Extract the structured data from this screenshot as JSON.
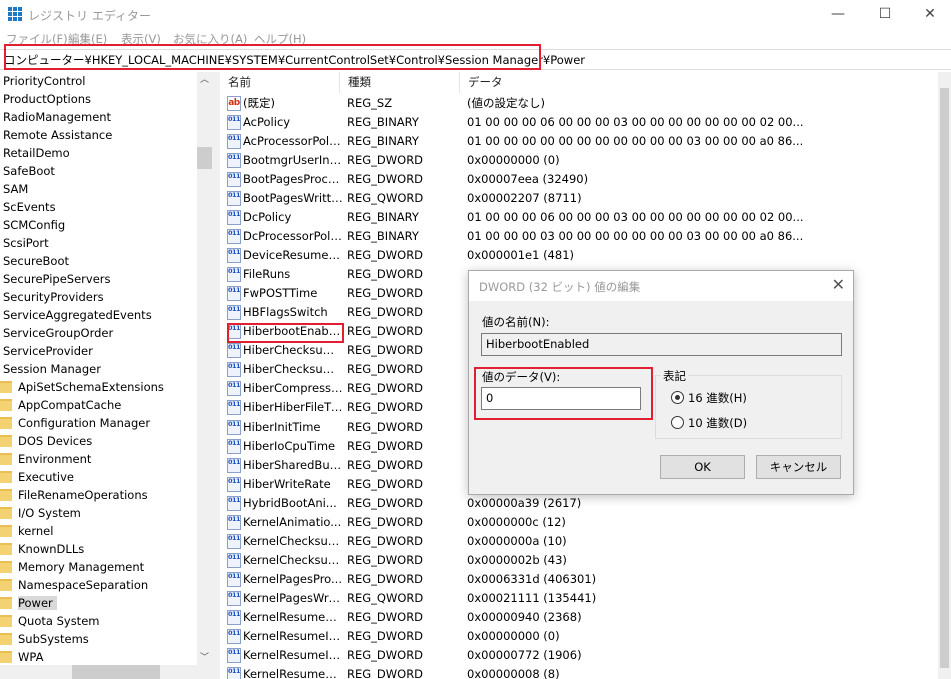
{
  "window": {
    "title": "レジストリ エディター",
    "minimize": "—",
    "maximize": "☐",
    "close": "✕"
  },
  "menu": [
    "ファイル(F)",
    "編集(E)",
    "表示(V)",
    "お気に入り(A)",
    "ヘルプ(H)"
  ],
  "address": "コンピューター¥HKEY_LOCAL_MACHINE¥SYSTEM¥CurrentControlSet¥Control¥Session Manager¥Power",
  "tree": {
    "items": [
      "PriorityControl",
      "ProductOptions",
      "RadioManagement",
      "Remote Assistance",
      "RetailDemo",
      "SafeBoot",
      "SAM",
      "ScEvents",
      "SCMConfig",
      "ScsiPort",
      "SecureBoot",
      "SecurePipeServers",
      "SecurityProviders",
      "ServiceAggregatedEvents",
      "ServiceGroupOrder",
      "ServiceProvider",
      "Session Manager"
    ],
    "children": [
      "ApiSetSchemaExtensions",
      "AppCompatCache",
      "Configuration Manager",
      "DOS Devices",
      "Environment",
      "Executive",
      "FileRenameOperations",
      "I/O System",
      "kernel",
      "KnownDLLs",
      "Memory Management",
      "NamespaceSeparation",
      "Power",
      "Quota System",
      "SubSystems",
      "WPA"
    ],
    "selected": "Power"
  },
  "columns": [
    "名前",
    "種類",
    "データ"
  ],
  "rows": [
    [
      "(既定)",
      "REG_SZ",
      "(値の設定なし)"
    ],
    [
      "AcPolicy",
      "REG_BINARY",
      "01 00 00 00 06 00 00 00 03 00 00 00 00 00 00 00 02 00..."
    ],
    [
      "AcProcessorPoli...",
      "REG_BINARY",
      "01 00 00 00 00 00 00 00 00 00 00 00 03 00 00 00 a0 86..."
    ],
    [
      "BootmgrUserInp...",
      "REG_DWORD",
      "0x00000000 (0)"
    ],
    [
      "BootPagesProce...",
      "REG_DWORD",
      "0x00007eea (32490)"
    ],
    [
      "BootPagesWritten",
      "REG_QWORD",
      "0x00002207 (8711)"
    ],
    [
      "DcPolicy",
      "REG_BINARY",
      "01 00 00 00 06 00 00 00 03 00 00 00 00 00 00 00 02 00..."
    ],
    [
      "DcProcessorPoli...",
      "REG_BINARY",
      "01 00 00 00 03 00 00 00 00 00 00 00 03 00 00 00 a0 86..."
    ],
    [
      "DeviceResumeTi...",
      "REG_DWORD",
      "0x000001e1 (481)"
    ],
    [
      "FileRuns",
      "REG_DWORD",
      ""
    ],
    [
      "FwPOSTTime",
      "REG_DWORD",
      ""
    ],
    [
      "HBFlagsSwitch",
      "REG_DWORD",
      ""
    ],
    [
      "HiberbootEnabled",
      "REG_DWORD",
      ""
    ],
    [
      "HiberChecksumI...",
      "REG_DWORD",
      ""
    ],
    [
      "HiberChecksum...",
      "REG_DWORD",
      ""
    ],
    [
      "HiberCompressR...",
      "REG_DWORD",
      ""
    ],
    [
      "HiberHiberFileTi...",
      "REG_DWORD",
      ""
    ],
    [
      "HiberInitTime",
      "REG_DWORD",
      ""
    ],
    [
      "HiberIoCpuTime",
      "REG_DWORD",
      ""
    ],
    [
      "HiberSharedBuff...",
      "REG_DWORD",
      ""
    ],
    [
      "HiberWriteRate",
      "REG_DWORD",
      ""
    ],
    [
      "HybridBootAni...",
      "REG_DWORD",
      "0x00000a39 (2617)"
    ],
    [
      "KernelAnimatio...",
      "REG_DWORD",
      "0x0000000c (12)"
    ],
    [
      "KernelChecksum...",
      "REG_DWORD",
      "0x0000000a (10)"
    ],
    [
      "KernelChecksum...",
      "REG_DWORD",
      "0x0000002b (43)"
    ],
    [
      "KernelPagesPro...",
      "REG_DWORD",
      "0x0006331d (406301)"
    ],
    [
      "KernelPagesWrit...",
      "REG_QWORD",
      "0x00021111 (135441)"
    ],
    [
      "KernelResumeHi...",
      "REG_DWORD",
      "0x00000940 (2368)"
    ],
    [
      "KernelResumeIni...",
      "REG_DWORD",
      "0x00000000 (0)"
    ],
    [
      "KernelResumeIo...",
      "REG_DWORD",
      "0x00000772 (1906)"
    ],
    [
      "KernelResumeSh...",
      "REG_DWORD",
      "0x00000008 (8)"
    ]
  ],
  "dialog": {
    "title": "DWORD (32 ビット) 値の編集",
    "close": "✕",
    "name_label": "値の名前(N):",
    "name_value": "HiberbootEnabled",
    "data_label": "値のデータ(V):",
    "data_value": "0",
    "base_label": "表記",
    "hex": "16 進数(H)",
    "dec": "10 進数(D)",
    "selected_base": "hex",
    "ok": "OK",
    "cancel": "キャンセル"
  },
  "icons": {
    "sz": "ab",
    "bin": "011\n110"
  },
  "colors": {
    "highlight": "#e02030"
  }
}
